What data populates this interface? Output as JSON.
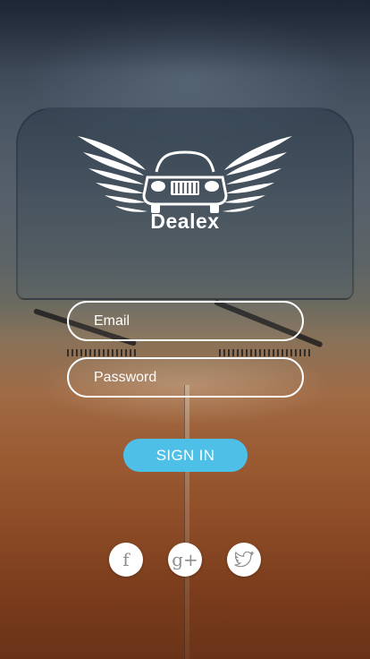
{
  "app": {
    "brand_name": "Dealex",
    "logo_icon": "winged-car-icon"
  },
  "form": {
    "email_placeholder": "Email",
    "password_placeholder": "Password",
    "signin_label": "SIGN IN"
  },
  "social": {
    "facebook_glyph": "f",
    "google_plus_glyph": "g+",
    "twitter_icon": "twitter-bird-icon"
  },
  "colors": {
    "accent": "#4ec0e8",
    "text": "#ffffff",
    "social_icon": "#8e8e8e"
  }
}
